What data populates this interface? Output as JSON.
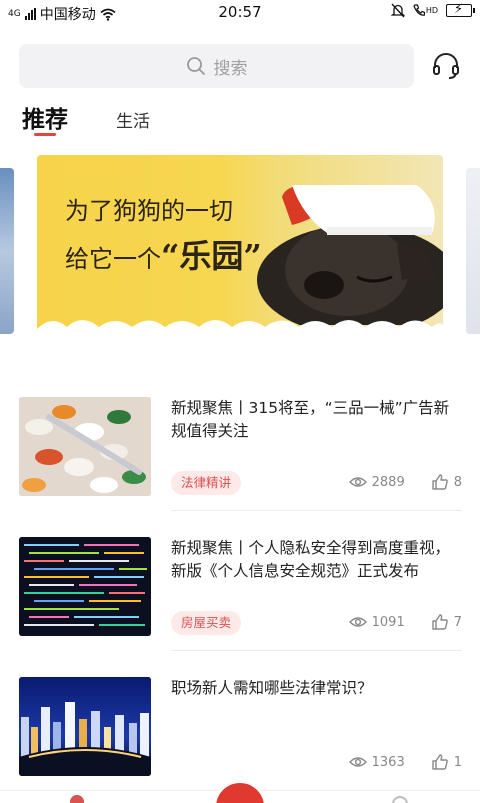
{
  "status_bar": {
    "network": "4G",
    "carrier": "中国移动",
    "time": "20:57",
    "hd_label": "HD"
  },
  "search": {
    "placeholder": "搜索"
  },
  "tabs": [
    {
      "label": "推荐",
      "active": true
    },
    {
      "label": "生活",
      "active": false
    }
  ],
  "banner": {
    "line1": "为了狗狗的一切",
    "line2_prefix": "给它一个",
    "line2_highlight": "“乐园”"
  },
  "articles": [
    {
      "title": "新规聚焦丨315将至，“三品一械”广告新规值得关注",
      "tag": "法律精讲",
      "views": "2889",
      "likes": "8",
      "thumb": "pills"
    },
    {
      "title": "新规聚焦丨个人隐私安全得到高度重视，新版《个人信息安全规范》正式发布",
      "tag": "房屋买卖",
      "views": "1091",
      "likes": "7",
      "thumb": "code"
    },
    {
      "title": "职场新人需知哪些法律常识？",
      "tag": "",
      "views": "1363",
      "likes": "1",
      "thumb": "city"
    }
  ],
  "colors": {
    "accent": "#e0463c",
    "tag_bg": "#fde9e8",
    "tag_text": "#d9534f",
    "search_bg": "#f2f2f4",
    "banner_yellow": "#f6d34a"
  }
}
